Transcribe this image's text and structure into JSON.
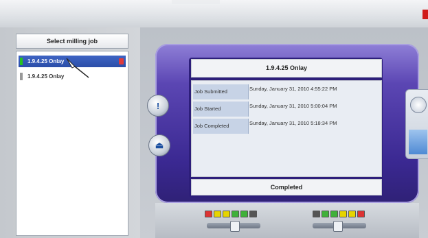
{
  "left_panel": {
    "header": "Select milling job",
    "jobs": [
      {
        "label": "1.9.4.25 Onlay",
        "selected": true
      },
      {
        "label": "1.9.4.25 Onlay",
        "selected": false
      }
    ]
  },
  "job_panel": {
    "title": "1.9.4.25 Onlay",
    "rows": [
      {
        "key": "Job Submitted",
        "value": "Sunday, January 31, 2010 4:55:22 PM"
      },
      {
        "key": "Job Started",
        "value": "Sunday, January 31, 2010 5:00:04 PM"
      },
      {
        "key": "Job Completed",
        "value": "Sunday, January 31, 2010 5:18:34 PM"
      }
    ],
    "status": "Completed"
  },
  "indicators": {
    "left_leds": [
      "#d33",
      "#e6d400",
      "#e6d400",
      "#3fb13a",
      "#3fb13a",
      "#555"
    ],
    "right_leds": [
      "#555",
      "#3fb13a",
      "#3fb13a",
      "#e6d400",
      "#e6d400",
      "#d33"
    ]
  },
  "icons": {
    "left_button_1": "alert-icon",
    "left_button_2": "stop-icon",
    "right_gauge": "gauge-icon"
  }
}
